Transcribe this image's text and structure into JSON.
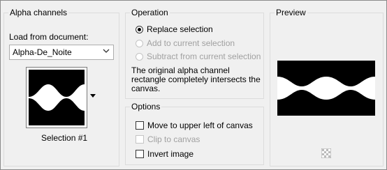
{
  "alpha": {
    "title": "Alpha channels",
    "load_label": "Load from document:",
    "document_value": "Alpha-De_Noite",
    "selection_name": "Selection #1"
  },
  "operation": {
    "title": "Operation",
    "options": [
      {
        "label": "Replace selection",
        "selected": true,
        "enabled": true
      },
      {
        "label": "Add to current selection",
        "selected": false,
        "enabled": false
      },
      {
        "label": "Subtract from current selection",
        "selected": false,
        "enabled": false
      }
    ],
    "note": "The original alpha channel rectangle completely intersects the canvas."
  },
  "options": {
    "title": "Options",
    "items": [
      {
        "label": "Move to upper left of canvas",
        "checked": false,
        "enabled": true
      },
      {
        "label": "Clip to canvas",
        "checked": false,
        "enabled": false
      },
      {
        "label": "Invert image",
        "checked": false,
        "enabled": true
      }
    ]
  },
  "preview": {
    "title": "Preview"
  },
  "icons": {
    "dropdown": "chevron-down-icon",
    "thumbnail_dropdown": "triangle-down-icon",
    "transparency": "transparency-checker-icon"
  }
}
